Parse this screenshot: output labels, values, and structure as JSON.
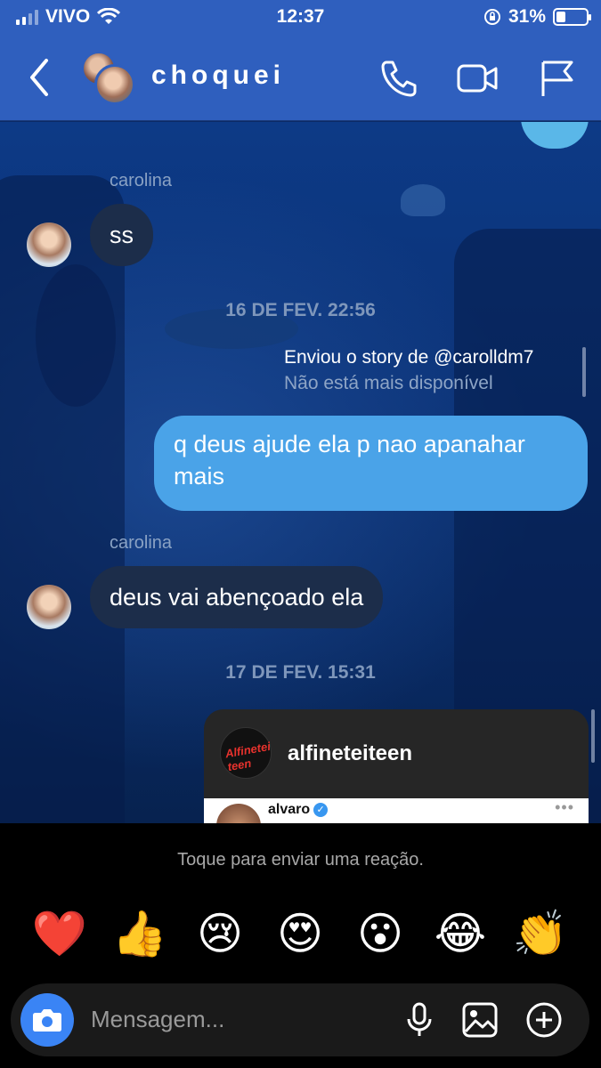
{
  "status_bar": {
    "carrier": "VIVO",
    "time": "12:37",
    "battery_percent_label": "31%",
    "battery_level": 0.31
  },
  "header": {
    "title": "choquei",
    "icons": [
      "back-chevron-icon",
      "phone-icon",
      "video-icon",
      "flag-icon"
    ]
  },
  "conversation": {
    "sender_label_1": "carolina",
    "message_1": "ss",
    "date_1": "16 DE FEV. 22:56",
    "story_reply_line1": "Enviou o story de @carolldm7",
    "story_reply_line2": "Não está mais disponível",
    "sent_message": "q deus ajude ela p nao apanahar mais",
    "sender_label_2": "carolina",
    "message_2": "deus vai abençoado ela",
    "date_2": "17 DE FEV. 15:31",
    "shared_post": {
      "account": "alfineteiteen",
      "avatar_logo_text": "Alfinetei teen",
      "inner_user": "alvaro",
      "inner_verified": true
    }
  },
  "reactions": {
    "hint": "Toque para enviar uma reação.",
    "emojis": [
      "❤️",
      "👍",
      "😢",
      "😍",
      "😮",
      "😂",
      "👏"
    ]
  },
  "composer": {
    "placeholder": "Mensagem...",
    "icons": [
      "camera-icon",
      "microphone-icon",
      "gallery-icon",
      "add-icon"
    ]
  },
  "colors": {
    "header_bg": "#2f5fbe",
    "sent_bubble": "#4aa3e8",
    "received_bubble": "#1c2d4a",
    "camera_button": "#3a84f5"
  }
}
